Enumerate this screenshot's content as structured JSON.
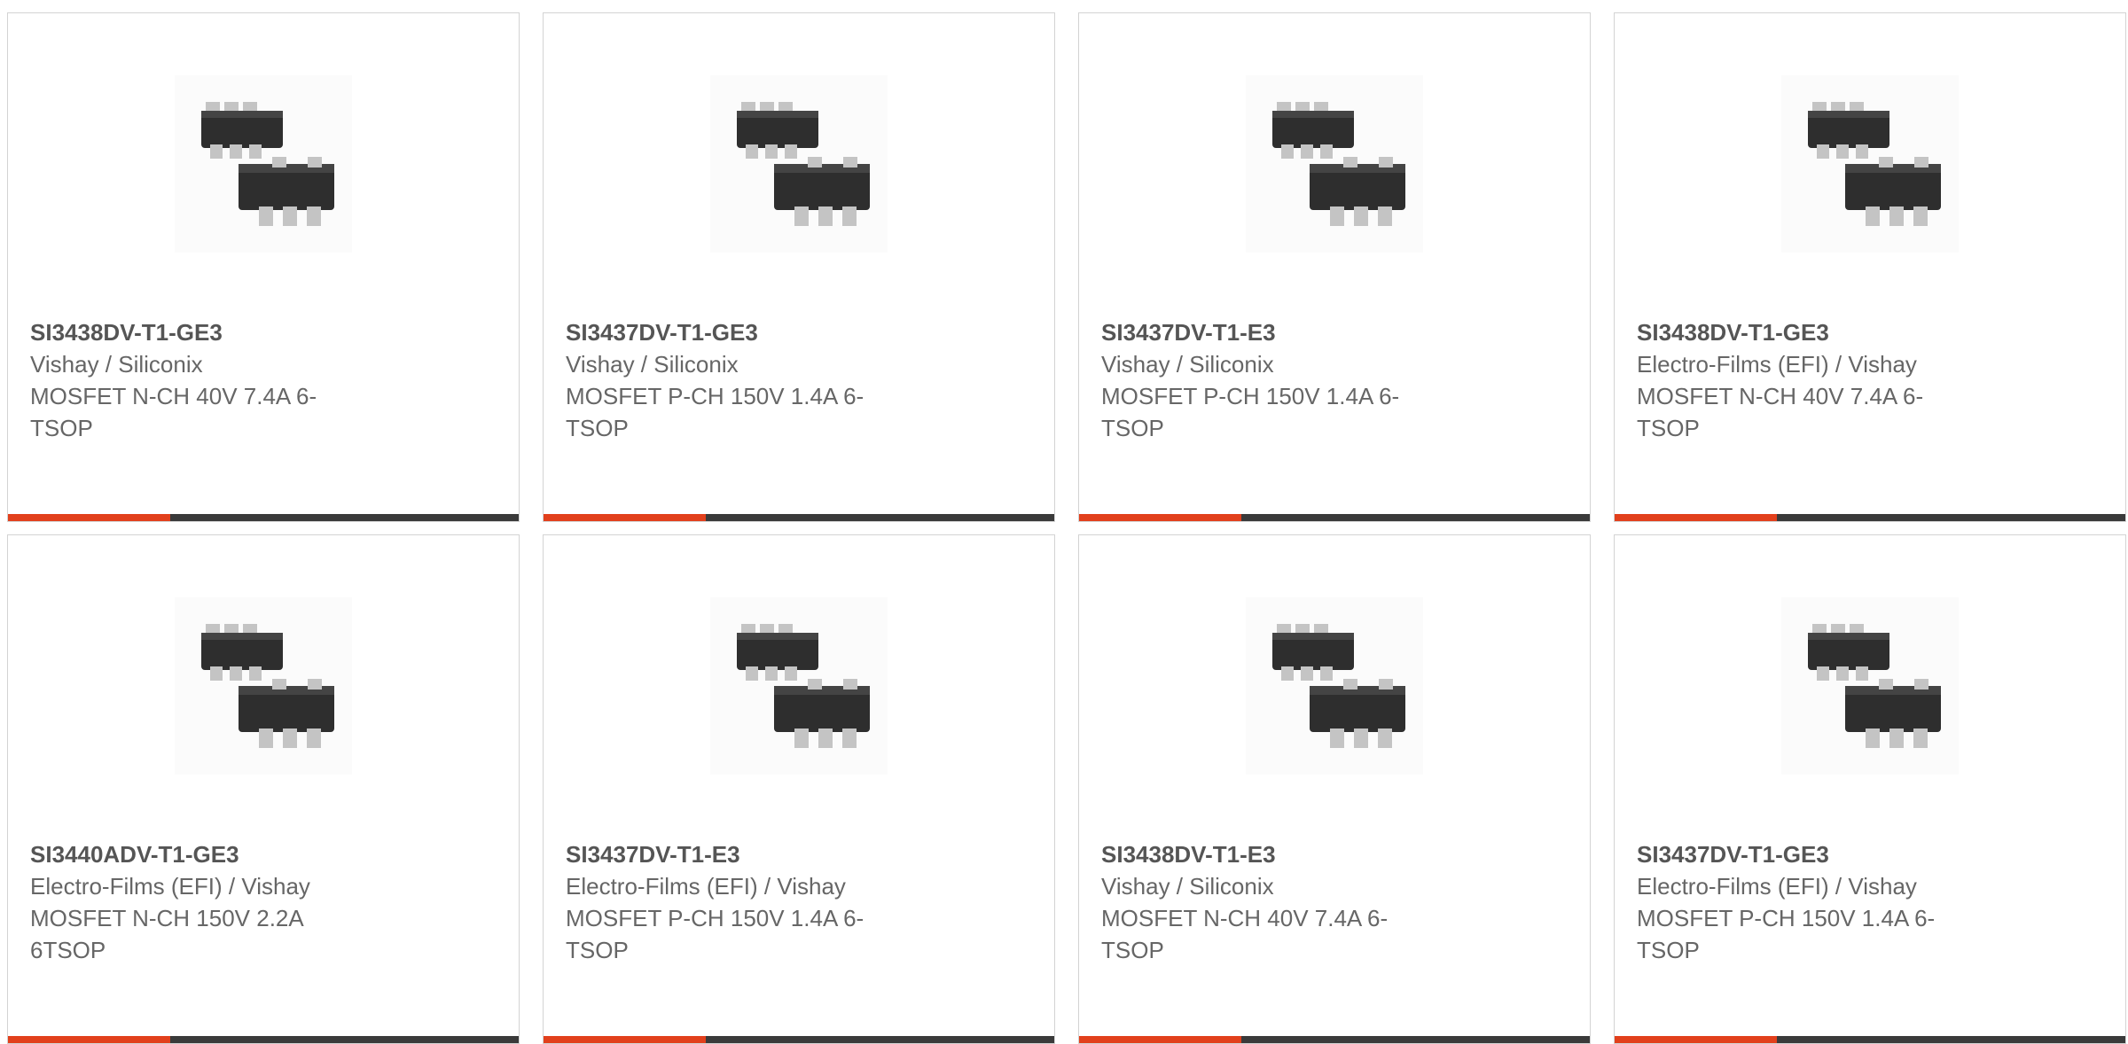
{
  "colors": {
    "accent": "#e2401c",
    "bar": "#3a3a3a",
    "chip_body": "#2f2f2f",
    "chip_pin": "#bdbdbd"
  },
  "products": [
    {
      "part_number": "SI3438DV-T1-GE3",
      "manufacturer": "Vishay / Siliconix",
      "description": "MOSFET N-CH 40V 7.4A 6-TSOP",
      "image_icon": "sot23-6-package-icon"
    },
    {
      "part_number": "SI3437DV-T1-GE3",
      "manufacturer": "Vishay / Siliconix",
      "description": "MOSFET P-CH 150V 1.4A 6-TSOP",
      "image_icon": "sot23-6-package-icon"
    },
    {
      "part_number": "SI3437DV-T1-E3",
      "manufacturer": "Vishay / Siliconix",
      "description": "MOSFET P-CH 150V 1.4A 6-TSOP",
      "image_icon": "sot23-6-package-icon"
    },
    {
      "part_number": "SI3438DV-T1-GE3",
      "manufacturer": "Electro-Films (EFI) / Vishay",
      "description": "MOSFET N-CH 40V 7.4A 6-TSOP",
      "image_icon": "sot23-6-package-icon"
    },
    {
      "part_number": "SI3440ADV-T1-GE3",
      "manufacturer": "Electro-Films (EFI) / Vishay",
      "description": "MOSFET N-CH 150V 2.2A 6TSOP",
      "image_icon": "sot23-6-package-icon"
    },
    {
      "part_number": "SI3437DV-T1-E3",
      "manufacturer": "Electro-Films (EFI) / Vishay",
      "description": "MOSFET P-CH 150V 1.4A 6-TSOP",
      "image_icon": "sot23-6-package-icon"
    },
    {
      "part_number": "SI3438DV-T1-E3",
      "manufacturer": "Vishay / Siliconix",
      "description": "MOSFET N-CH 40V 7.4A 6-TSOP",
      "image_icon": "sot23-6-package-icon"
    },
    {
      "part_number": "SI3437DV-T1-GE3",
      "manufacturer": "Electro-Films (EFI) / Vishay",
      "description": "MOSFET P-CH 150V 1.4A 6-TSOP",
      "image_icon": "sot23-6-package-icon"
    }
  ]
}
